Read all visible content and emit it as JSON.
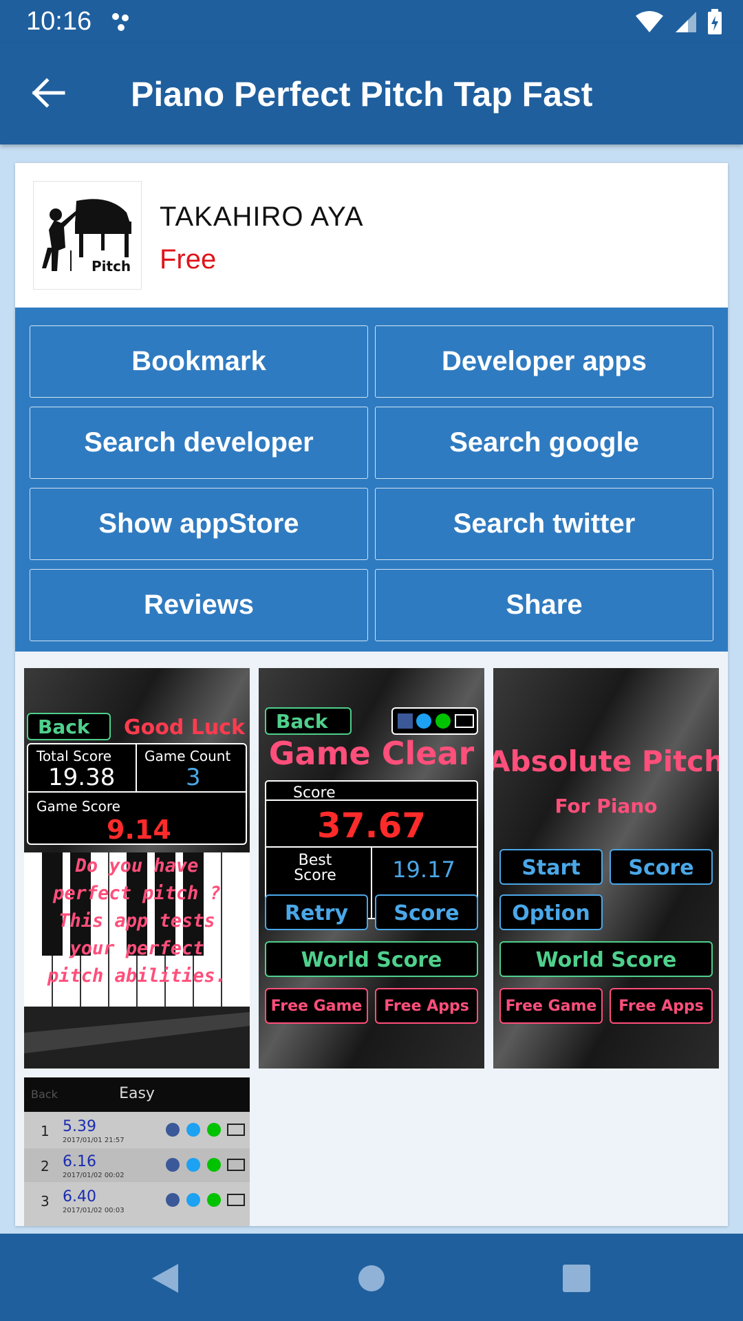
{
  "status_bar": {
    "time": "10:16"
  },
  "toolbar": {
    "title": "Piano Perfect Pitch Tap Fast"
  },
  "app": {
    "icon_caption": "Pitch",
    "developer": "TAKAHIRO AYA",
    "price": "Free"
  },
  "buttons": {
    "bookmark": "Bookmark",
    "developer_apps": "Developer apps",
    "search_developer": "Search developer",
    "search_google": "Search google",
    "show_appstore": "Show appStore",
    "search_twitter": "Search twitter",
    "reviews": "Reviews",
    "share": "Share"
  },
  "screenshot1": {
    "back": "Back",
    "good_luck": "Good Luck",
    "total_score_label": "Total Score",
    "total_score": "19.38",
    "game_count_label": "Game Count",
    "game_count": "3",
    "game_score_label": "Game Score",
    "game_score": "9.14",
    "line1": "Do you have",
    "line2": "perfect pitch ?",
    "line3": "This app tests",
    "line4": "your perfect",
    "line5": "pitch abilities."
  },
  "screenshot2": {
    "back": "Back",
    "game_clear": "Game Clear",
    "score_label": "Score",
    "score": "37.67",
    "best_label_1": "Best",
    "best_label_2": "Score",
    "best_score": "19.17",
    "retry": "Retry",
    "score_btn": "Score",
    "world_score": "World Score",
    "free_game": "Free Game",
    "free_apps": "Free Apps"
  },
  "screenshot3": {
    "title": "Absolute Pitch",
    "subtitle": "For Piano",
    "start": "Start",
    "score": "Score",
    "option": "Option",
    "world_score": "World Score",
    "free_game": "Free Game",
    "free_apps": "Free Apps"
  },
  "screenshot4": {
    "back": "Back",
    "title": "Easy",
    "rows": [
      {
        "rank": "1",
        "score": "5.39",
        "date": "2017/01/01  21:57"
      },
      {
        "rank": "2",
        "score": "6.16",
        "date": "2017/01/02  00:02"
      },
      {
        "rank": "3",
        "score": "6.40",
        "date": "2017/01/02  00:03"
      }
    ]
  },
  "colors": {
    "primary": "#1f5f9e",
    "button_panel": "#2f7bc1",
    "price": "#e0141a",
    "game_pink": "#ff4f7b",
    "game_green": "#4fd08c",
    "game_blue": "#4aa8e8"
  }
}
